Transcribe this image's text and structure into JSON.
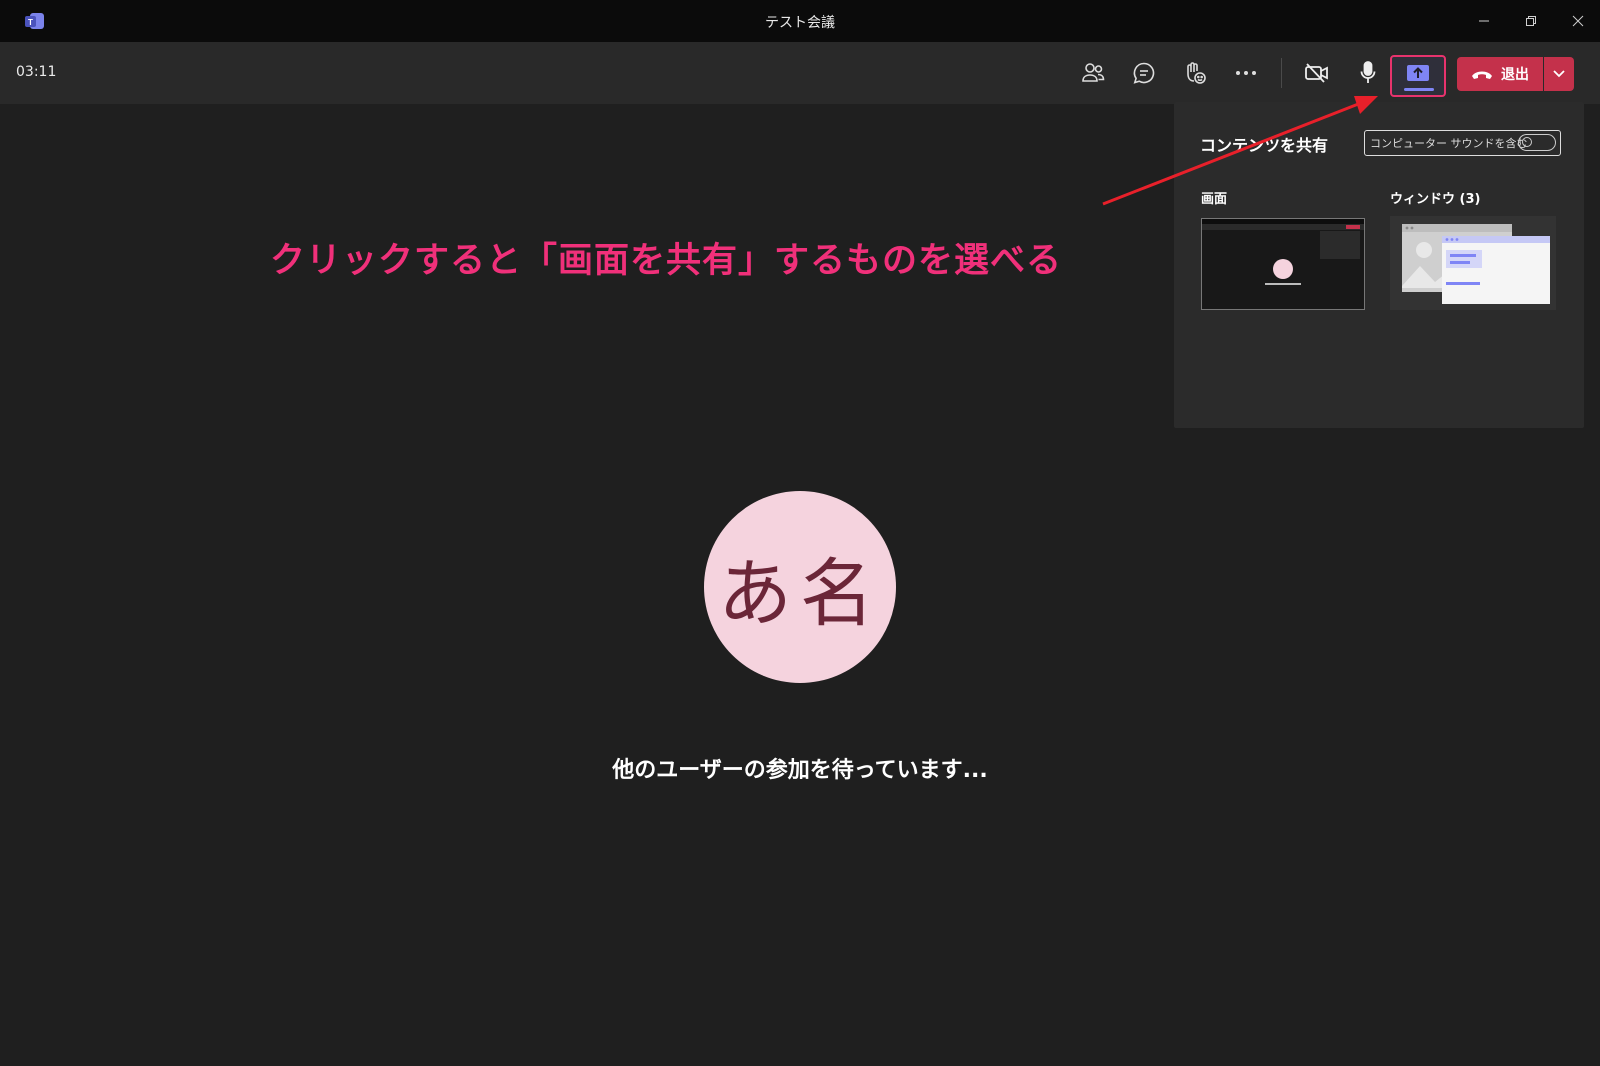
{
  "window": {
    "title": "テスト会議",
    "app_icon": "teams-icon"
  },
  "toolbar": {
    "timer": "03:11",
    "buttons": [
      {
        "name": "participants-icon"
      },
      {
        "name": "chat-icon"
      },
      {
        "name": "reactions-icon"
      },
      {
        "name": "more-options-icon"
      },
      {
        "name": "camera-off-icon"
      },
      {
        "name": "microphone-icon"
      },
      {
        "name": "share-screen-icon"
      }
    ],
    "leave_label": "退出"
  },
  "share_panel": {
    "title": "コンテンツを共有",
    "include_sound_label": "コンピューター サウンドを含む",
    "include_sound_on": false,
    "screen_label": "画面",
    "window_label": "ウィンドウ (3)"
  },
  "annotation": {
    "text": "クリックすると「画面を共有」するものを選べる",
    "color": "#f0307a"
  },
  "main": {
    "avatar_initials": "あ名",
    "waiting_text": "他のユーザーの参加を待っています..."
  },
  "colors": {
    "background": "#1f1f1f",
    "toolbar": "#292929",
    "leave": "#c4314b",
    "accent": "#7f85f5",
    "avatar_bg": "#f5d3de"
  }
}
